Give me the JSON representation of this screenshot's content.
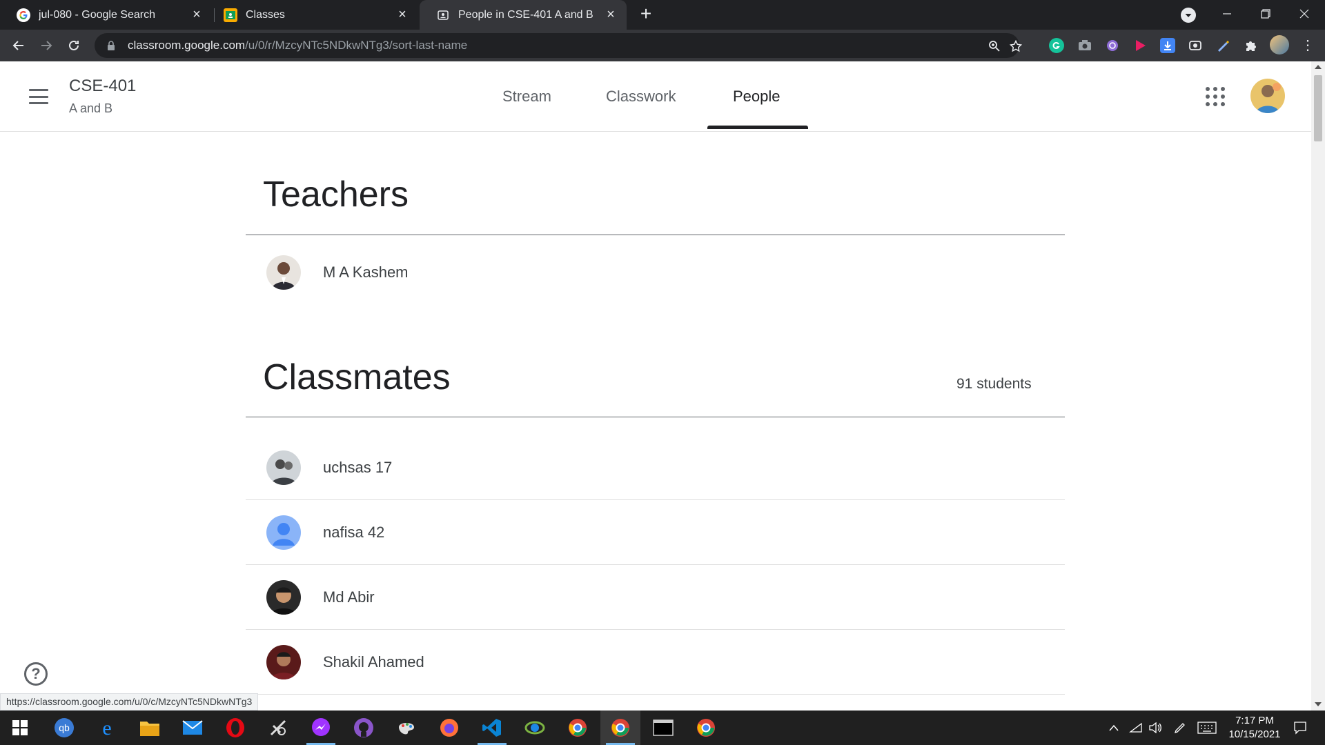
{
  "browser": {
    "tabs": [
      {
        "title": "jul-080 - Google Search",
        "icon": "google-icon",
        "active": false
      },
      {
        "title": "Classes",
        "icon": "classroom-icon",
        "active": false
      },
      {
        "title": "People in CSE-401 A and B",
        "icon": "people-icon",
        "active": true
      }
    ],
    "url_host": "classroom.google.com",
    "url_path": "/u/0/r/MzcyNTc5NDkwNTg3/sort-last-name",
    "status_url": "https://classroom.google.com/u/0/c/MzcyNTc5NDkwNTg3"
  },
  "header": {
    "class_name": "CSE-401",
    "section": "A and B",
    "nav": [
      {
        "label": "Stream",
        "active": false
      },
      {
        "label": "Classwork",
        "active": false
      },
      {
        "label": "People",
        "active": true
      }
    ]
  },
  "teachers": {
    "title": "Teachers",
    "people": [
      {
        "name": "M A Kashem",
        "avatar": "photo"
      }
    ]
  },
  "classmates": {
    "title": "Classmates",
    "count_label": "91 students",
    "people": [
      {
        "name": "uchsas 17",
        "avatar": "photo"
      },
      {
        "name": "nafisa 42",
        "avatar": "default-person"
      },
      {
        "name": "Md Abir",
        "avatar": "photo"
      },
      {
        "name": "Shakil Ahamed",
        "avatar": "photo"
      }
    ]
  },
  "taskbar": {
    "time": "7:17 PM",
    "date": "10/15/2021"
  },
  "colors": {
    "chrome_dark": "#202124",
    "chrome_toolbar": "#35363a",
    "text_primary": "#202124",
    "text_secondary": "#5f6368",
    "default_avatar": "#4285f4"
  }
}
